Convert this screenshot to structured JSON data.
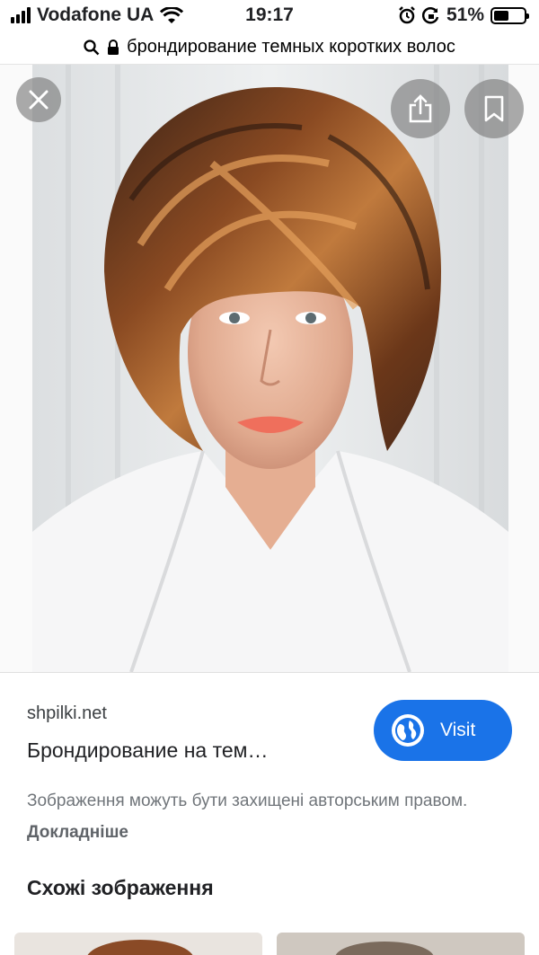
{
  "status_bar": {
    "carrier": "Vodafone UA",
    "time": "19:17",
    "battery": "51%",
    "battery_level": 0.51
  },
  "url_bar": {
    "query": "брондирование темных коротких волос"
  },
  "result": {
    "source": "shpilki.net",
    "title": "Брондирование на тем…",
    "visit_label": "Visit",
    "copyright_text": "Зображення можуть бути захищені авторським правом.",
    "copyright_link": "Докладніше"
  },
  "similar_heading": "Схожі зображення",
  "colors": {
    "accent": "#1a73e8",
    "overlay_button": "#787878"
  },
  "icons": [
    "signal-icon",
    "wifi-icon",
    "alarm-icon",
    "rotation-lock-icon",
    "battery-icon",
    "search-icon",
    "lock-icon",
    "close-icon",
    "share-icon",
    "bookmark-icon",
    "globe-icon"
  ]
}
